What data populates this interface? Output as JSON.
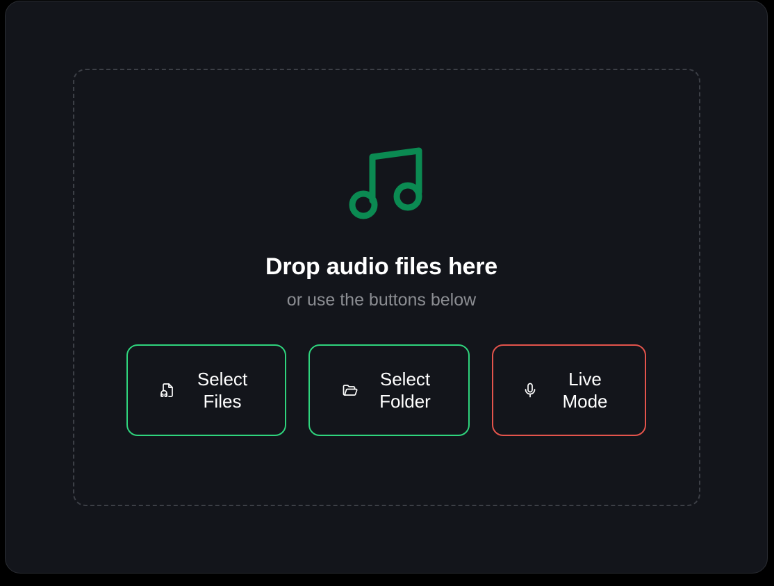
{
  "dropzone": {
    "icon": "music-note-icon",
    "title": "Drop audio files here",
    "subtitle": "or use the buttons below"
  },
  "buttons": [
    {
      "line1": "Select",
      "line2": "Files",
      "icon": "audio-file-icon",
      "accent": "#2fd47d"
    },
    {
      "line1": "Select",
      "line2": "Folder",
      "icon": "folder-open-icon",
      "accent": "#2fd47d"
    },
    {
      "line1": "Live",
      "line2": "Mode",
      "icon": "microphone-icon",
      "accent": "#e4544c"
    }
  ],
  "colors": {
    "icon_green": "#0b8a52",
    "background": "#13151b",
    "border": "#3c3f46"
  }
}
